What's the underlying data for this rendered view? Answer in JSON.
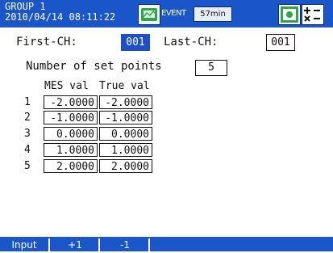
{
  "header": {
    "group_title": "GROUP 1",
    "datetime": "2010/04/14 08:11:22",
    "event_label": "EVENT",
    "timer": "57min"
  },
  "channels": {
    "first_label": "First-CH:",
    "first_value": "001",
    "last_label": "Last-CH:",
    "last_value": "001"
  },
  "setpoints": {
    "label": "Number of set points",
    "value": "5"
  },
  "table": {
    "headers": [
      "MES val",
      "True val"
    ],
    "rows": [
      {
        "num": "1",
        "mes": "-2.0000",
        "true": "-2.0000"
      },
      {
        "num": "2",
        "mes": "-1.0000",
        "true": "-1.0000"
      },
      {
        "num": "3",
        "mes": "0.0000",
        "true": "0.0000"
      },
      {
        "num": "4",
        "mes": "1.0000",
        "true": "1.0000"
      },
      {
        "num": "5",
        "mes": "2.0000",
        "true": "2.0000"
      }
    ]
  },
  "softkeys": [
    "Input",
    "+1",
    "-1"
  ],
  "colors": {
    "header_bg": "#1a56c8",
    "selected_bg": "#1f4fc4",
    "icon_green": "#2fa64a"
  },
  "icons": [
    "memory-icon",
    "display-mode-icon",
    "calc-icon"
  ]
}
